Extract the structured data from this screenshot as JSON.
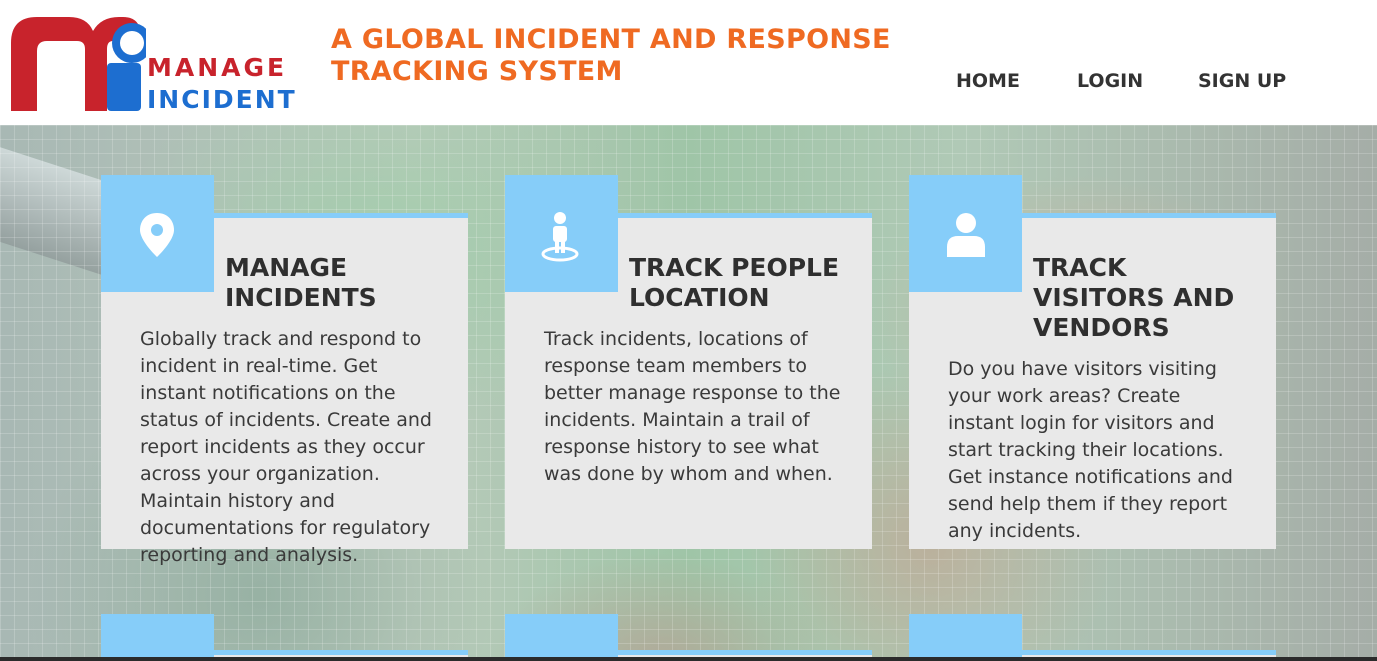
{
  "header": {
    "logo_line1": "MANAGE",
    "logo_line2": "INCIDENT",
    "tagline_line1": "A GLOBAL INCIDENT AND RESPONSE",
    "tagline_line2": "TRACKING SYSTEM"
  },
  "nav": {
    "home": "HOME",
    "login": "LOGIN",
    "signup": "SIGN UP"
  },
  "colors": {
    "accent_orange": "#ef6a22",
    "logo_red": "#c8232c",
    "logo_blue": "#1d6ed0",
    "card_accent": "#86cdf9",
    "card_bg": "#e9e9e9"
  },
  "cards": [
    {
      "icon": "map-pin-icon",
      "title_line1": "MANAGE",
      "title_line2": "INCIDENTS",
      "text": "Globally track and respond to incident in real-time. Get instant notifications on the status of incidents. Create and report incidents as they occur across your organization. Maintain history and documentations for regulatory reporting and analysis."
    },
    {
      "icon": "person-location-icon",
      "title_line1": "TRACK PEOPLE",
      "title_line2": "LOCATION",
      "text": "Track incidents, locations of response team members to better manage response to the incidents. Maintain a trail of response history to see what was done by whom and when."
    },
    {
      "icon": "user-icon",
      "title_line1": "TRACK",
      "title_line2": "VISITORS AND",
      "title_line3": "VENDORS",
      "text": "Do you have visitors visiting your work areas? Create instant login for visitors and start tracking their locations. Get instance notifications and send help them if they report any incidents."
    }
  ]
}
